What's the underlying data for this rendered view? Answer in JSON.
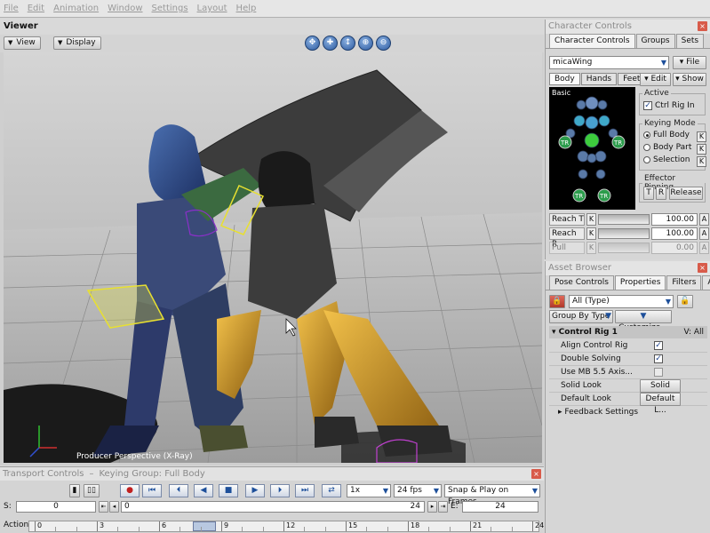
{
  "menu": [
    "File",
    "Edit",
    "Animation",
    "Window",
    "Settings",
    "Layout",
    "Help"
  ],
  "viewer": {
    "title": "Viewer",
    "view_label": "View",
    "display_label": "Display",
    "perspective": "Producer Perspective (X-Ray)"
  },
  "character_controls": {
    "title": "Character Controls",
    "tabs": [
      "Character Controls",
      "Groups",
      "Sets"
    ],
    "character": "micaWing",
    "file_label": "File",
    "subtabs": [
      "Body",
      "Hands",
      "Feet"
    ],
    "edit_label": "Edit",
    "show_label": "Show",
    "basic_label": "Basic",
    "tr_label": "TR",
    "active_title": "Active",
    "ctrl_rig_in": "Ctrl Rig In",
    "keying_mode_title": "Keying Mode",
    "keying_modes": [
      "Full Body",
      "Body Part",
      "Selection"
    ],
    "k_label": "K",
    "effector_title": "Effector Pinning",
    "t_label": "T",
    "r_label": "R",
    "release_label": "Release",
    "reach": [
      {
        "name": "Reach T",
        "value": "100.00"
      },
      {
        "name": "Reach R",
        "value": "100.00"
      },
      {
        "name": "Pull",
        "value": "0.00"
      }
    ],
    "a_label": "A"
  },
  "asset_browser": {
    "title": "Asset Browser",
    "tabs": [
      "Pose Controls",
      "Properties",
      "Filters",
      "Asse"
    ],
    "type_filter": "All (Type)",
    "group_by": "Group By Type",
    "customize": "Customize...",
    "group_title": "Control Rig 1",
    "group_value": "V: All",
    "props": [
      {
        "label": "Align Control Rig",
        "kind": "check",
        "value": true
      },
      {
        "label": "Double Solving",
        "kind": "check",
        "value": true
      },
      {
        "label": "Use MB 5.5 Axis...",
        "kind": "check",
        "value": false
      },
      {
        "label": "Solid Look",
        "kind": "button",
        "value": "Solid Look"
      },
      {
        "label": "Default Look",
        "kind": "button",
        "value": "Default L..."
      }
    ],
    "feedback": "Feedback Settings"
  },
  "transport": {
    "title": "Transport Controls",
    "keying_group": "Keying Group: Full Body",
    "speed": "1x",
    "fps": "24 fps",
    "snap": "Snap & Play on Frames",
    "s_label": "S:",
    "start": "0",
    "e_label": "E:",
    "end": "24",
    "current_start": "0",
    "current_end": "24",
    "action_label": "Action",
    "ticks": [
      "0",
      "3",
      "6",
      "9",
      "12",
      "15",
      "18",
      "21",
      "24"
    ]
  }
}
